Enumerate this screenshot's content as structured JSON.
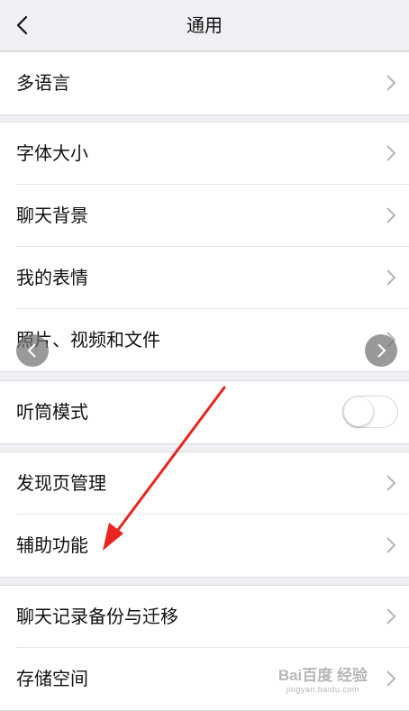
{
  "header": {
    "title": "通用"
  },
  "settings": {
    "language": "多语言",
    "font_size": "字体大小",
    "chat_background": "聊天背景",
    "my_stickers": "我的表情",
    "photos_videos_files": "照片、视频和文件",
    "earpiece_mode": "听筒模式",
    "discover_management": "发现页管理",
    "accessibility": "辅助功能",
    "chat_backup_migrate": "聊天记录备份与迁移",
    "storage": "存储空间"
  },
  "earpiece_mode_enabled": false,
  "watermark": {
    "main": "Bai百度 经验",
    "sub": "jingyan.baidu.com"
  },
  "colors": {
    "background": "#efeff4",
    "cell": "#ffffff",
    "annotation_arrow": "#e8251f"
  }
}
